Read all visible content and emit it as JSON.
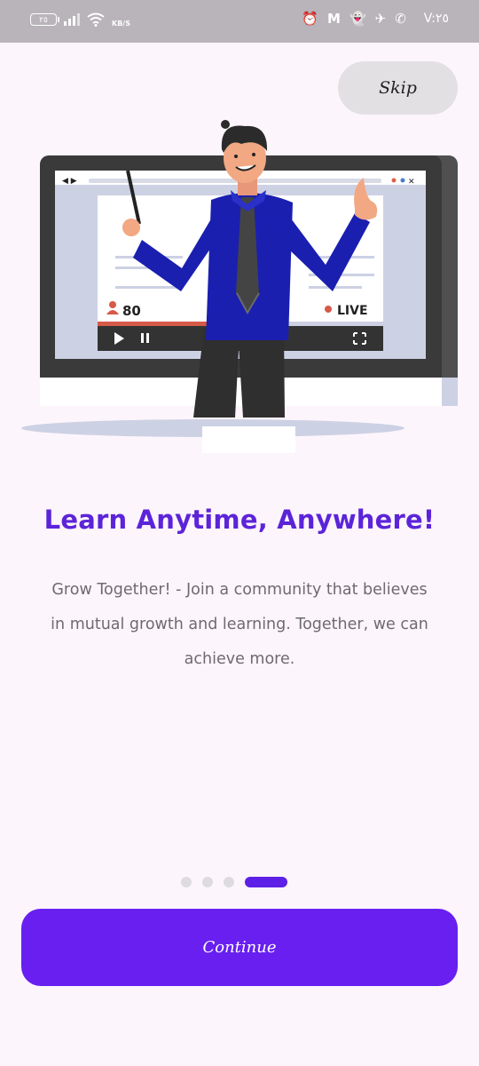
{
  "status_bar": {
    "battery_text": "٢٥",
    "net_speed_unit": "KB/S",
    "time": "V:٢٥"
  },
  "skip_label": "Skip",
  "illustration": {
    "viewer_count": "80",
    "live_label": "LIVE"
  },
  "heading": "Learn Anytime, Anywhere!",
  "description": "Grow Together! - Join a community that believes in mutual growth and learning. Together, we can achieve more.",
  "pager": {
    "total": 4,
    "current": 4
  },
  "continue_label": "Continue",
  "colors": {
    "accent": "#681ff0",
    "title": "#5c24d9",
    "background": "#fdf5fc"
  }
}
